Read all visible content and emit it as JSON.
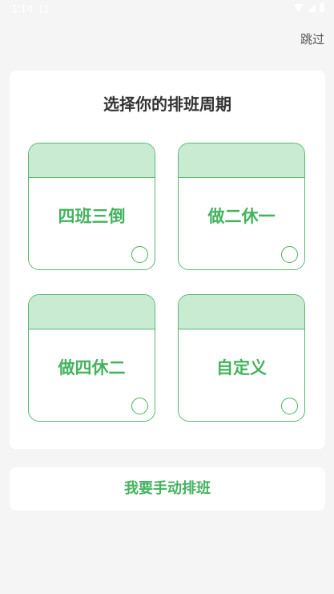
{
  "status_bar": {
    "time": "1:14"
  },
  "header": {
    "skip_label": "跳过"
  },
  "main": {
    "title": "选择你的排班周期",
    "options": [
      {
        "label": "四班三倒"
      },
      {
        "label": "做二休一"
      },
      {
        "label": "做四休二"
      },
      {
        "label": "自定义"
      }
    ]
  },
  "footer": {
    "manual_label": "我要手动排班"
  },
  "colors": {
    "accent": "#44b35e",
    "option_header": "#c9ebd1",
    "background": "#f5f5f5"
  }
}
